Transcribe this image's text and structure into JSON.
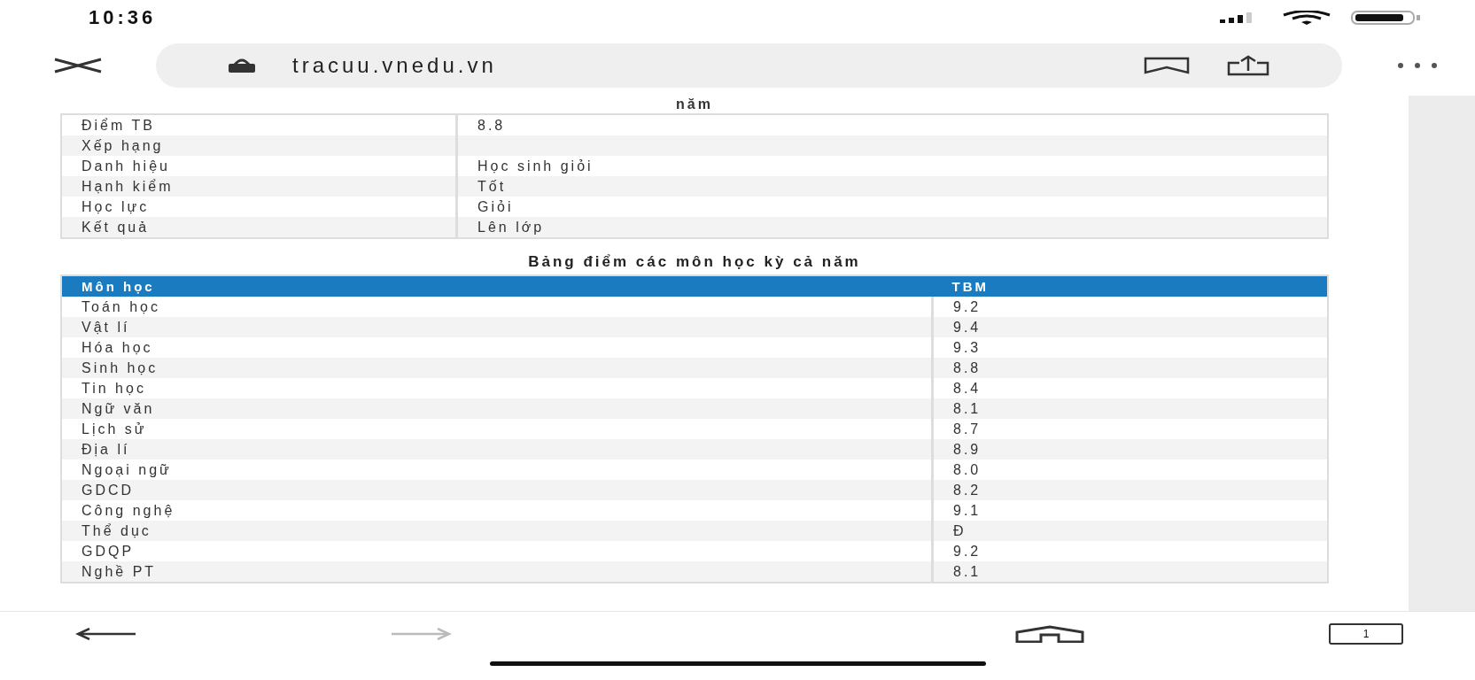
{
  "status_bar": {
    "time": "10:36"
  },
  "browser": {
    "url": "tracuu.vnedu.vn",
    "tab_count": "1"
  },
  "page": {
    "heading_tail": "năm",
    "summary": [
      {
        "label": "Điểm TB",
        "value": "8.8"
      },
      {
        "label": "Xếp hạng"
      },
      {
        "label": "Danh hiệu",
        "value": "Học sinh giỏi"
      },
      {
        "label": "Hạnh kiểm",
        "value": "Tốt"
      },
      {
        "label": "Học lực",
        "value": "Giỏi"
      },
      {
        "label": "Kết quả",
        "value": "Lên lớp"
      }
    ],
    "grades": {
      "caption": "Bảng điểm các môn học kỳ cả năm",
      "columns": [
        "Môn học",
        "TBM"
      ],
      "rows": [
        [
          "Toán học",
          "9.2"
        ],
        [
          "Vật lí",
          "9.4"
        ],
        [
          "Hóa học",
          "9.3"
        ],
        [
          "Sinh học",
          "8.8"
        ],
        [
          "Tin học",
          "8.4"
        ],
        [
          "Ngữ văn",
          "8.1"
        ],
        [
          "Lịch sử",
          "8.7"
        ],
        [
          "Địa lí",
          "8.9"
        ],
        [
          "Ngoại ngữ",
          "8.0"
        ],
        [
          "GDCD",
          "8.2"
        ],
        [
          "Công nghệ",
          "9.1"
        ],
        [
          "Thể dục",
          "Đ"
        ],
        [
          "GDQP",
          "9.2"
        ],
        [
          "Nghề PT",
          "8.1"
        ]
      ]
    }
  }
}
